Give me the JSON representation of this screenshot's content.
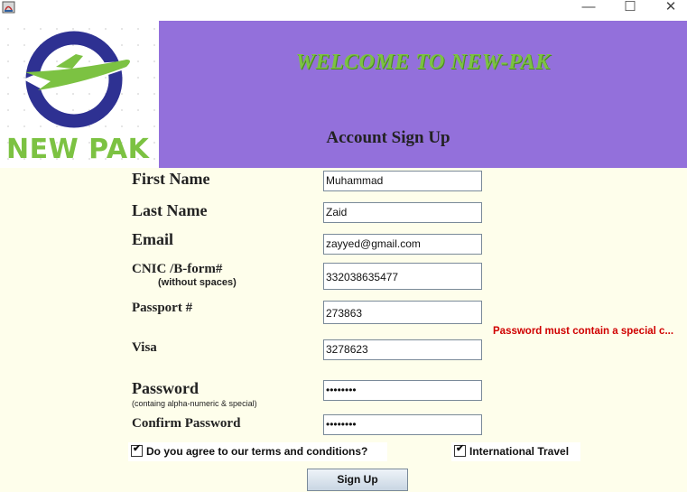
{
  "window": {
    "minimize_glyph": "—",
    "maximize_glyph": "☐",
    "close_glyph": "✕"
  },
  "logo": {
    "text": "NEW PAK",
    "ring_color": "#2e3192",
    "plane_color": "#7cc242"
  },
  "banner": {
    "welcome": "WELCOME TO NEW-PAK",
    "title": "Account Sign Up",
    "background": "#9370db",
    "accent": "#7cc242"
  },
  "form": {
    "first_name": {
      "label": "First Name",
      "value": "Muhammad"
    },
    "last_name": {
      "label": "Last Name",
      "value": "Zaid"
    },
    "email": {
      "label": "Email",
      "value": "zayyed@gmail.com"
    },
    "cnic": {
      "label": "CNIC /B-form#",
      "hint": "(without spaces)",
      "value": "332038635477"
    },
    "passport": {
      "label": "Passport #",
      "value": "273863"
    },
    "visa": {
      "label": "Visa",
      "value": "3278623"
    },
    "password": {
      "label": "Password",
      "hint": "(containg alpha-numeric & special)",
      "value": "••••••••"
    },
    "confirm_password": {
      "label": "Confirm Password",
      "value": "••••••••"
    },
    "error": "Password must contain a special c...",
    "terms": {
      "label": "Do you agree to our terms and conditions?",
      "checked": true
    },
    "international": {
      "label": "International Travel",
      "checked": true
    },
    "submit_label": "Sign Up"
  }
}
